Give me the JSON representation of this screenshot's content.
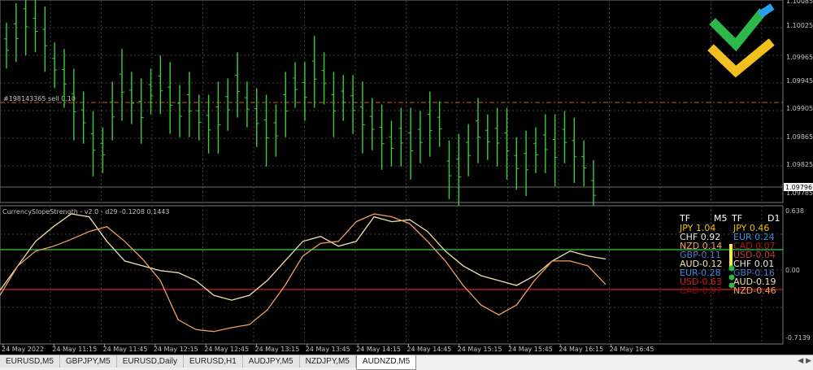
{
  "price_axis": {
    "labels": [
      "1.10085",
      "1.10025",
      "1.09965",
      "1.09945",
      "1.09905",
      "1.09865",
      "1.09825",
      "1.09785"
    ],
    "current_price": "1.09796"
  },
  "order_line_label": "#198143365 sell 0.10",
  "indicator": {
    "title": "CurrencySlopeStrength - v2.0 - d29 -0.1208 0.1443",
    "scale_labels": [
      "0.638",
      "0.00",
      "-0.7139"
    ]
  },
  "time_labels": [
    "24 May 2022",
    "24 May 11:15",
    "24 May 11:45",
    "24 May 12:15",
    "24 May 12:45",
    "24 May 13:15",
    "24 May 13:45",
    "24 May 14:15",
    "24 May 14:45",
    "24 May 15:15",
    "24 May 15:45",
    "24 May 16:15",
    "24 May 16:45"
  ],
  "strength_table": {
    "headers": [
      "TF",
      "M5",
      "TF",
      "D1"
    ],
    "rows": [
      {
        "left": "JPY 1.04",
        "right": "JPY 0.46",
        "lc": "#f0c000",
        "rc": "#f0c000"
      },
      {
        "left": "CHF 0.92",
        "right": "EUR 0.24",
        "lc": "#e6e6e6",
        "rc": "#3a8ee6"
      },
      {
        "left": "NZD 0.14",
        "right": "CAD 0.07",
        "lc": "#f0a060",
        "rc": "#b01818"
      },
      {
        "left": "GBP-0.11",
        "right": "USD-0.04",
        "lc": "#4a78c8",
        "rc": "#c83a3a"
      },
      {
        "left": "AUD-0.12",
        "right": "CHF 0.01",
        "lc": "#f0e0b0",
        "rc": "#e6e6e6"
      },
      {
        "left": "EUR-0.28",
        "right": "GBP-0.16",
        "lc": "#3a8ee6",
        "rc": "#4a78c8"
      },
      {
        "left": "USD-0.63",
        "right": "AUD-0.19",
        "lc": "#d02020",
        "rc": "#f0e0b0"
      },
      {
        "left": "CAD-0.97",
        "right": "NZD-0.46",
        "lc": "#8a1010",
        "rc": "#f0a060"
      }
    ]
  },
  "tabs": [
    "EURUSD,M5",
    "GBPJPY,M5",
    "EURUSD,Daily",
    "EURUSD,H1",
    "AUDJPY,M5",
    "NZDJPY,M5",
    "AUDNZD,M5"
  ],
  "active_tab": "AUDNZD,M5",
  "logo_icon": "litefinance-logo-icon",
  "colors": {
    "bars": "#3ccc3c",
    "aud_line": "#f0e0b0",
    "nzd_line": "#f0a060",
    "upper_level": "#3ccc3c",
    "lower_level": "#d02020"
  },
  "chart_data": [
    {
      "type": "ohlc",
      "title": "",
      "series": [
        {
          "name": "",
          "values": [
            1.1002,
            1.1004,
            1.1006,
            1.1005,
            1.1003,
            1.0999,
            1.0997,
            1.0993,
            1.0991,
            1.0987,
            1.0986,
            1.0992,
            1.0996,
            1.0994,
            1.0992,
            1.0995,
            1.0996,
            1.0994,
            1.0992,
            1.0993,
            1.0991,
            1.099,
            1.0991,
            1.0993,
            1.0996,
            1.0993,
            1.0991,
            1.0989,
            1.0989,
            1.0993,
            1.0996,
            1.0995,
            1.0998,
            1.0997,
            1.0993,
            1.0994,
            1.0993,
            1.0991,
            1.099,
            1.0988,
            1.0987,
            1.0988,
            1.0987,
            1.0988,
            1.099,
            1.099,
            1.0983,
            1.0983,
            1.0986,
            1.0989,
            1.0988,
            1.0988,
            1.0987,
            1.0984,
            1.0984,
            1.0986,
            1.0987,
            1.0986,
            1.0988,
            1.0986,
            1.0984,
            1.098
          ]
        }
      ],
      "xlabel": "",
      "ylabel": "",
      "ylim": [
        1.0978,
        1.1009
      ]
    },
    {
      "type": "line",
      "title": "CurrencySlopeStrength - v2.0 - d29 -0.1208 0.1443",
      "series": [
        {
          "name": "AUD",
          "values": [
            -0.2,
            0.05,
            0.3,
            0.45,
            0.58,
            0.55,
            0.3,
            0.1,
            0.05,
            0.0,
            -0.02,
            -0.1,
            -0.25,
            -0.3,
            -0.25,
            -0.1,
            0.1,
            0.3,
            0.35,
            0.25,
            0.3,
            0.55,
            0.5,
            0.52,
            0.4,
            0.2,
            0.05,
            -0.05,
            -0.1,
            -0.15,
            -0.05,
            0.1,
            0.2,
            0.15,
            0.12
          ]
        },
        {
          "name": "NZD",
          "values": [
            -0.25,
            0.05,
            0.2,
            0.25,
            0.32,
            0.4,
            0.45,
            0.3,
            0.12,
            -0.1,
            -0.5,
            -0.6,
            -0.62,
            -0.58,
            -0.55,
            -0.4,
            -0.15,
            0.15,
            0.28,
            0.3,
            0.5,
            0.58,
            0.55,
            0.48,
            0.3,
            0.1,
            -0.15,
            -0.35,
            -0.45,
            -0.35,
            -0.1,
            0.1,
            0.1,
            0.05,
            -0.14
          ]
        }
      ],
      "levels": [
        0.2,
        -0.2
      ],
      "xlabel": "",
      "ylabel": "",
      "ylim": [
        -0.7139,
        0.638
      ]
    }
  ]
}
